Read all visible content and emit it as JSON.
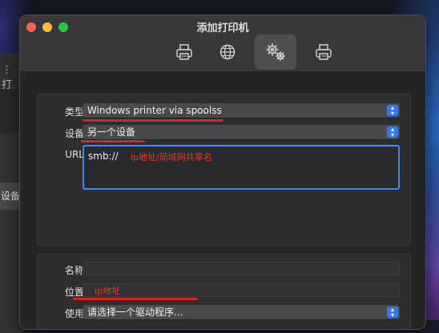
{
  "window": {
    "title": "添加打印机"
  },
  "toolbar": {
    "tabs": [
      {
        "icon": "printer-icon"
      },
      {
        "icon": "globe-icon"
      },
      {
        "icon": "gears-icon",
        "active": true
      },
      {
        "icon": "printer-icon"
      }
    ]
  },
  "background_app": {
    "toolbar_glyph": "⋮ 打",
    "sidebar_label": "设备"
  },
  "form": {
    "type_label": "类型：",
    "type_value": "Windows printer via spoolss",
    "device_label": "设备：",
    "device_value": "另一个设备",
    "url_label": "URL：",
    "url_value": "smb://",
    "url_annotation": "ip地址/局域网共享名",
    "name_label": "名称：",
    "location_label": "位置：",
    "location_annotation": "ip地址",
    "use_label": "使用：",
    "use_value": "请选择一个驱动程序..."
  },
  "colors": {
    "accent": "#3478f6",
    "annotation": "#e33a2a"
  }
}
